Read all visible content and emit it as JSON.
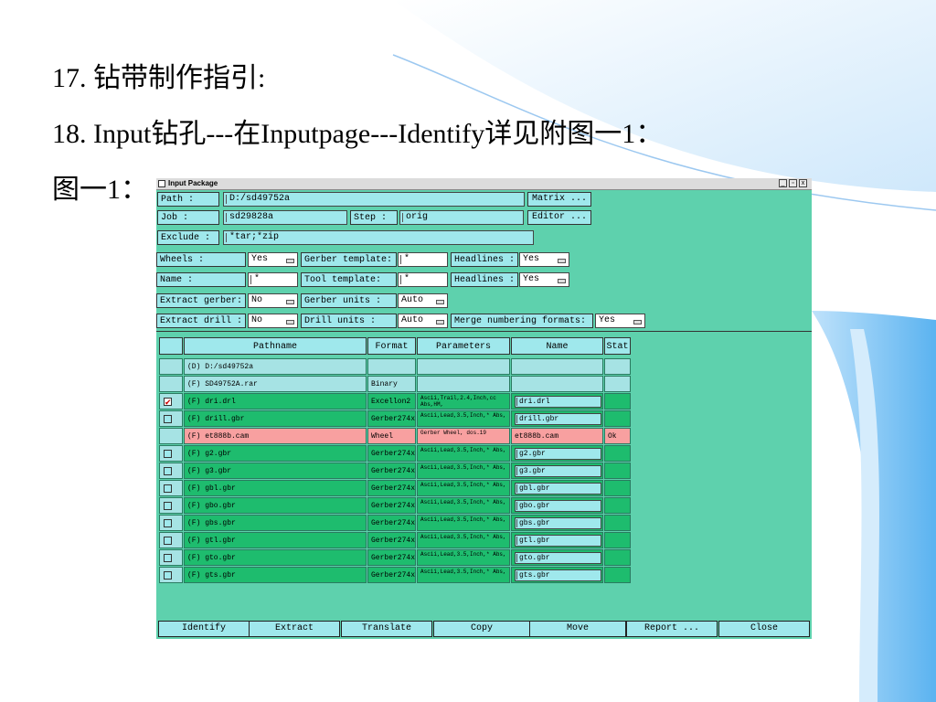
{
  "slide": {
    "line1": "17. 钻带制作指引:",
    "line2": "18. Input钻孔---在Inputpage---Identify详见附图一1：",
    "line3": "图一1："
  },
  "window": {
    "title": "Input Package",
    "controls": [
      "_",
      "▫",
      "x"
    ]
  },
  "form": {
    "path_label": "Path    :",
    "path_value": "D:/sd49752a",
    "matrix_button": "Matrix ...",
    "job_label": "Job     :",
    "job_value": "sd29828a",
    "step_label": "Step :",
    "step_value": "orig",
    "editor_button": "Editor ...",
    "exclude_label": "Exclude :",
    "exclude_value": "*tar;*zip",
    "wheels_label": "Wheels          :",
    "wheels_value": "Yes",
    "gerber_template_label": "Gerber template:",
    "gerber_template_value": "*",
    "headlines1_label": "Headlines :",
    "headlines1_value": "Yes",
    "name_label": "Name            :",
    "name_value": "*",
    "tool_template_label": "Tool   template:",
    "tool_template_value": "*",
    "headlines2_label": "Headlines :",
    "headlines2_value": "Yes",
    "extract_gerber_label": "Extract gerber:",
    "extract_gerber_value": "No",
    "gerber_units_label": "Gerber units   :",
    "gerber_units_value": "Auto",
    "extract_drill_label": "Extract drill :",
    "extract_drill_value": "No",
    "drill_units_label": "Drill  units   :",
    "drill_units_value": "Auto",
    "merge_label": "Merge numbering formats:",
    "merge_value": "Yes"
  },
  "table": {
    "headers": [
      "",
      "Pathname",
      "Format",
      "Parameters",
      "Name",
      "Stat"
    ],
    "rows": [
      {
        "kind": "dir",
        "check": "none",
        "path": "(D) D:/sd49752a",
        "format": "",
        "params": "",
        "name": "",
        "stat": ""
      },
      {
        "kind": "dir",
        "check": "none",
        "path": "(F) SD49752A.rar",
        "format": "Binary",
        "params": "",
        "name": "",
        "stat": ""
      },
      {
        "kind": "file",
        "check": "checked",
        "path": "(F) dri.drl",
        "format": "Excellon2",
        "params": "Ascii,Trail,2.4,Inch,cc Abs,HM,",
        "name": "dri.drl",
        "stat": ""
      },
      {
        "kind": "file",
        "check": "empty",
        "path": "(F) drill.gbr",
        "format": "Gerber274x",
        "params": "Ascii,Lead,3.5,Inch,* Abs,",
        "name": "drill.gbr",
        "stat": ""
      },
      {
        "kind": "wheel",
        "check": "none",
        "path": "(F) et888b.cam",
        "format": "Wheel",
        "params": "Gerber Wheel, dos.19",
        "name": "et888b.cam",
        "stat": "Ok"
      },
      {
        "kind": "file",
        "check": "empty",
        "path": "(F) g2.gbr",
        "format": "Gerber274x",
        "params": "Ascii,Lead,3.5,Inch,* Abs,",
        "name": "g2.gbr",
        "stat": ""
      },
      {
        "kind": "file",
        "check": "empty",
        "path": "(F) g3.gbr",
        "format": "Gerber274x",
        "params": "Ascii,Lead,3.5,Inch,* Abs,",
        "name": "g3.gbr",
        "stat": ""
      },
      {
        "kind": "file",
        "check": "empty",
        "path": "(F) gbl.gbr",
        "format": "Gerber274x",
        "params": "Ascii,Lead,3.5,Inch,* Abs,",
        "name": "gbl.gbr",
        "stat": ""
      },
      {
        "kind": "file",
        "check": "empty",
        "path": "(F) gbo.gbr",
        "format": "Gerber274x",
        "params": "Ascii,Lead,3.5,Inch,* Abs,",
        "name": "gbo.gbr",
        "stat": ""
      },
      {
        "kind": "file",
        "check": "empty",
        "path": "(F) gbs.gbr",
        "format": "Gerber274x",
        "params": "Ascii,Lead,3.5,Inch,* Abs,",
        "name": "gbs.gbr",
        "stat": ""
      },
      {
        "kind": "file",
        "check": "empty",
        "path": "(F) gtl.gbr",
        "format": "Gerber274x",
        "params": "Ascii,Lead,3.5,Inch,* Abs,",
        "name": "gtl.gbr",
        "stat": ""
      },
      {
        "kind": "file",
        "check": "empty",
        "path": "(F) gto.gbr",
        "format": "Gerber274x",
        "params": "Ascii,Lead,3.5,Inch,* Abs,",
        "name": "gto.gbr",
        "stat": ""
      },
      {
        "kind": "file",
        "check": "empty",
        "path": "(F) gts.gbr",
        "format": "Gerber274x",
        "params": "Ascii,Lead,3.5,Inch,* Abs,",
        "name": "gts.gbr",
        "stat": ""
      }
    ]
  },
  "buttons": {
    "identify": "Identify",
    "extract": "Extract",
    "translate": "Translate",
    "copy": "Copy",
    "move": "Move",
    "report": "Report ...",
    "close": "Close"
  },
  "colors": {
    "window_bg": "#5ed1ad",
    "field_bg": "#9fe8ec",
    "dir_row": "#a6e3e4",
    "file_row": "#1ebc6e",
    "wheel_row": "#f8a0a0"
  }
}
